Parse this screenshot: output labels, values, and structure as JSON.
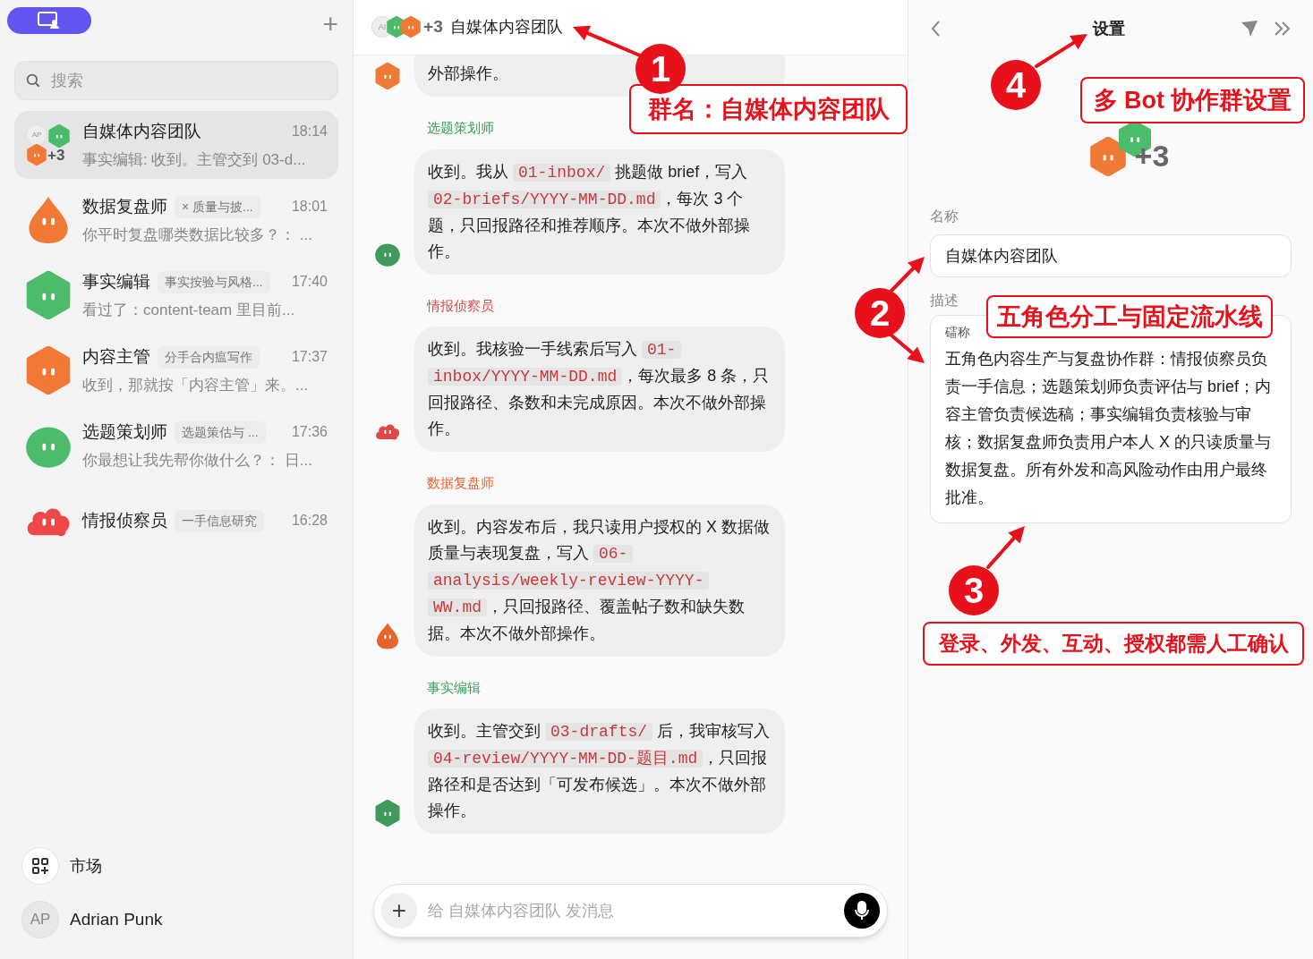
{
  "sidebar": {
    "plus": "+",
    "search": {
      "placeholder": "搜索"
    },
    "conversations": [
      {
        "name": "自媒体内容团队",
        "time": "18:14",
        "preview": "事实编辑: 收到。主管交到 03-d...",
        "selected": true,
        "group": {
          "initials": "AP",
          "members": [
            {
              "kind": "hexagon",
              "color": "#4cbb6a"
            },
            {
              "kind": "hexagon",
              "color": "#f07a35"
            }
          ],
          "more": "+3"
        }
      },
      {
        "name": "数据复盘师",
        "tag": "× 质量与披...",
        "time": "18:01",
        "preview": "你平时复盘哪类数据比较多？： ...",
        "selected": false,
        "avatar": {
          "kind": "drop",
          "color": "#f07a35"
        }
      },
      {
        "name": "事实编辑",
        "tag": "事实按验与风格...",
        "time": "17:40",
        "preview": "看过了：content-team 里目前...",
        "selected": false,
        "avatar": {
          "kind": "hexagon",
          "color": "#4cbb6a"
        }
      },
      {
        "name": "内容主管",
        "tag": "分手合内瘟写作",
        "time": "17:37",
        "preview": "收到，那就按「内容主管」来。...",
        "selected": false,
        "avatar": {
          "kind": "hexagon",
          "color": "#f07a35"
        }
      },
      {
        "name": "选题策划师",
        "tag": "选题策估与 ...",
        "time": "17:36",
        "preview": "你最想让我先帮你做什么？： 日...",
        "selected": false,
        "avatar": {
          "kind": "blob",
          "color": "#4cbb6a"
        }
      },
      {
        "name": "情报侦察员",
        "tag": "一手信息研究",
        "time": "16:28",
        "selected": false,
        "avatar": {
          "kind": "cloud",
          "color": "#ef4848"
        }
      }
    ],
    "market": "市场",
    "user": {
      "initials": "AP",
      "name": "Adrian Punk"
    }
  },
  "chat": {
    "header": {
      "initials": "AI",
      "members": [
        {
          "kind": "hexagon",
          "color": "#4cbb6a"
        },
        {
          "kind": "hexagon",
          "color": "#f07a35"
        }
      ],
      "more": "+3",
      "title": "自媒体内容团队"
    },
    "messages": [
      {
        "avatar": {
          "kind": "hexagon",
          "color": "#f07a35"
        },
        "segments": [
          {
            "kind": "text",
            "text": "外部操作。"
          }
        ]
      },
      {
        "name": "选题策划师",
        "avatar": {
          "kind": "blob",
          "color": "#3f9a5c"
        },
        "segments": [
          {
            "kind": "text",
            "text": "收到。我从 "
          },
          {
            "kind": "code",
            "text": "01-inbox/"
          },
          {
            "kind": "text",
            "text": " 挑题做 brief，写入 "
          },
          {
            "kind": "code",
            "text": "02-briefs/YYYY-MM-DD.md"
          },
          {
            "kind": "text",
            "text": "，每次 3 个题，只回报路径和推荐顺序。本次不做外部操作。"
          }
        ]
      },
      {
        "name": "情报侦察员",
        "avatar": {
          "kind": "cloud",
          "color": "#e04848"
        },
        "segments": [
          {
            "kind": "text",
            "text": "收到。我核验一手线索后写入 "
          },
          {
            "kind": "code",
            "text": "01-inbox/YYYY-MM-DD.md"
          },
          {
            "kind": "text",
            "text": "，每次最多 8 条，只回报路径、条数和未完成原因。本次不做外部操作。"
          }
        ]
      },
      {
        "name": "数据复盘师",
        "avatar": {
          "kind": "drop",
          "color": "#e8642f"
        },
        "segments": [
          {
            "kind": "text",
            "text": "收到。内容发布后，我只读用户授权的 X 数据做质量与表现复盘，写入 "
          },
          {
            "kind": "code",
            "text": "06-analysis/weekly-review-YYYY-WW.md"
          },
          {
            "kind": "text",
            "text": "，只回报路径、覆盖帖子数和缺失数据。本次不做外部操作。"
          }
        ]
      },
      {
        "name": "事实编辑",
        "avatar": {
          "kind": "hexagon",
          "color": "#3f9a5c"
        },
        "segments": [
          {
            "kind": "text",
            "text": "收到。主管交到 "
          },
          {
            "kind": "code",
            "text": "03-drafts/"
          },
          {
            "kind": "text",
            "text": " 后，我审核写入 "
          },
          {
            "kind": "code",
            "text": "04-review/YYYY-MM-DD-题目.md"
          },
          {
            "kind": "text",
            "text": "，只回报路径和是否达到「可发布候选」。本次不做外部操作。"
          }
        ]
      }
    ],
    "composer": {
      "plus": "+",
      "placeholder": "给 自媒体内容团队 发消息"
    }
  },
  "settings": {
    "title": "设置",
    "avatar": {
      "members": [
        {
          "kind": "hexagon",
          "color": "#4cbb6a"
        },
        {
          "kind": "hexagon",
          "color": "#f07a35"
        }
      ],
      "more": "+3"
    },
    "name_label": "名称",
    "name_value": "自媒体内容团队",
    "desc_label": "描述",
    "desc_hint": "礌称",
    "desc_value": "五角色内容生产与复盘协作群：情报侦察员负责一手信息；选题策划师负责评估与 brief；内容主管负责候选稿；事实编辑负责核验与审核；数据复盘师负责用户本人 X 的只读质量与数据复盘。所有外发和高风险动作由用户最终批准。"
  },
  "annotations": [
    {
      "number": "1",
      "label": "群名：自媒体内容团队"
    },
    {
      "number": "4",
      "label": "多 Bot 协作群设置"
    },
    {
      "number": "2",
      "label": "五角色分工与固定流水线"
    },
    {
      "number": "3",
      "label": "登录、外发、互动、授权都需人工确认"
    }
  ]
}
